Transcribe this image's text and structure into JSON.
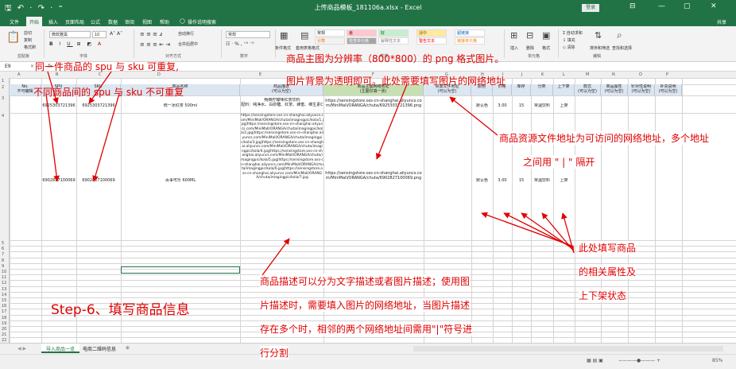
{
  "window": {
    "title": "上传商品模板_181106a.xlsx  -  Excel",
    "quick_access": "🖫 ↶ · ↷ · ⁼",
    "login": "登录",
    "controls": [
      "⊟",
      "—",
      "▢",
      "✕"
    ]
  },
  "menu": {
    "tabs": [
      "文件",
      "开始",
      "插入",
      "页面布局",
      "公式",
      "数据",
      "审阅",
      "视图",
      "帮助"
    ],
    "search": "操作说明搜索",
    "share": "共享"
  },
  "ribbon": {
    "clipboard": {
      "cut": "剪切",
      "copy": "复制",
      "format_painter": "格式刷",
      "group": "剪贴板"
    },
    "font": {
      "name": "微软雅黑",
      "size": "10",
      "group": "字体"
    },
    "alignment": {
      "wrap": "自动换行",
      "merge": "合并后居中",
      "group": "对齐方式"
    },
    "number": {
      "format": "常规",
      "group": "数字"
    },
    "styles": {
      "conditional": "条件格式",
      "table": "套用表格格式",
      "cells": [
        {
          "label": "常规",
          "bg": "#ffffff",
          "fg": "#222222"
        },
        {
          "label": "差",
          "bg": "#ffc7ce",
          "fg": "#9c0006"
        },
        {
          "label": "好",
          "bg": "#c6efce",
          "fg": "#006100"
        },
        {
          "label": "适中",
          "bg": "#ffeb9c",
          "fg": "#9c5700"
        },
        {
          "label": "超链接",
          "bg": "#ffffff",
          "fg": "#0563c1"
        },
        {
          "label": "计算",
          "bg": "#f2f2f2",
          "fg": "#fa7d00"
        },
        {
          "label": "检查单元格",
          "bg": "#a5a5a5",
          "fg": "#ffffff"
        },
        {
          "label": "解释性文本",
          "bg": "#ffffff",
          "fg": "#7f7f7f"
        },
        {
          "label": "警告文本",
          "bg": "#ffffff",
          "fg": "#ff0000"
        },
        {
          "label": "链接单元格",
          "bg": "#ffffff",
          "fg": "#fa7d00"
        }
      ],
      "group": "样式"
    },
    "cells": {
      "insert": "插入",
      "delete": "删除",
      "format": "格式",
      "group": "单元格"
    },
    "editing": {
      "autosum": "自动求和",
      "fill": "填充",
      "clear": "清除",
      "sort": "排序和筛选",
      "find": "查找和选择",
      "group": "编辑"
    }
  },
  "formula_bar": {
    "name_box": "E9",
    "fx": "fx"
  },
  "columns": [
    "A",
    "B",
    "C",
    "D",
    "E",
    "F",
    "G",
    "H",
    "I",
    "J",
    "K",
    "L",
    "M",
    "N",
    "O",
    "P"
  ],
  "header_row": {
    "a": "No.\n不可编辑",
    "b": "SPU",
    "c": "SKU",
    "d": "商品名称",
    "e": "商品描述\n(可以为空)",
    "f": "商品主图网络地址\n(主图仅填一张)",
    "g": "资源文件地址\n(可以为空)",
    "h": "颜色",
    "i": "价格",
    "j": "库存",
    "k": "分类",
    "l": "上下架",
    "m": "款式\n(可以为空)",
    "n": "商品属性\n(可以为空)",
    "o": "针对性说明\n(可以为空)",
    "p": "补充说明\n(可以为空)"
  },
  "rows": [
    {
      "spu": "6925303721396",
      "sku": "6925303721396",
      "name": "统一冰红茶 500ml",
      "desc": "畅爽柠檬味红茶饮料\n配料：纯净水、白砂糖、红茶、蜂蜜、维生素C",
      "image": "https://sensingstore.oss-cn-shanghai.aliyuncs.com/MiniMall/ORANGA/chuta/6925303721396.png",
      "color": "默认色",
      "price": "3.00",
      "stock": "15",
      "category": "常温饮料",
      "shelf": "上架"
    },
    {
      "spu": "6902827100069",
      "sku": "6902827100069",
      "name": "百事可乐 600ML",
      "desc": "https://sensingstore.oss-cn-shanghai.aliyuncs.com/MiniMall/ORANGA/chuta/imagingpic/kola/1.jpg|https://sensingstore.oss-cn-shanghai.aliyuncs.com/MiniMall/ORANGA/chuta/imagingpic/kola/2.jpg|https://sensingstore.oss-cn-shanghai.aliyuncs.com/MiniMall/ORANGA/chuta/imagingpic/kola/3.jpg|https://sensingstore.oss-cn-shanghai.aliyuncs.com/MiniMall/ORANGA/chuta/imagingpic/kola/4.jpg|https://sensingstore.oss-cn-shanghai.aliyuncs.com/MiniMall/ORANGA/chuta/imagingpic/kola/5.jpg|https://sensingstore.oss-cn-shanghai.aliyuncs.com/MiniMall/ORANGA/chuta/imagingpic/kola/6.jpg|https://sensingstore.oss-cn-shanghai.aliyuncs.com/MiniMall/ORANGA/chuta/imagingpic/kola/7.jpg",
      "image": "https://sensingstore.oss-cn-shanghai.aliyuncs.com/MiniMall/ORANGA/chuta/6902827100069.png",
      "color": "默认色",
      "price": "3.00",
      "stock": "15",
      "category": "常温饮料",
      "shelf": "上架"
    }
  ],
  "row_numbers": [
    "1",
    "2",
    "3",
    "4",
    "5",
    "6",
    "7",
    "8",
    "9",
    "10",
    "11",
    "12",
    "13",
    "14",
    "15",
    "16",
    "17",
    "18",
    "19",
    "20",
    "21",
    "22"
  ],
  "sheet_tabs": [
    "导入商品一览",
    "电商二维码信息"
  ],
  "status": {
    "zoom": "85%"
  },
  "annotations": {
    "same_product": "同一件商品的 spu 与 sku 可重复,",
    "diff_product": "不同商品间的 spu 与 sku 不可重复",
    "image_res": "商品主图为分辨率（800*800）的 png 格式图片。",
    "image_bg": "图片背景为透明即可。此处需要填写图片的网络地址",
    "resource_1": "商品资源文件地址为可访问的网络地址，多个地址",
    "resource_2": "之间用 \" | \" 隔开",
    "attr_1": "此处填写商品",
    "attr_2": "的相关属性及",
    "attr_3": "上下架状态",
    "desc_1": "商品描述可以分为文字描述或者图片描述；使用图",
    "desc_2": "片描述时，需要填入图片的网络地址，当图片描述",
    "desc_3": "存在多个时，相邻的两个网络地址间需用\"|\"符号进",
    "desc_4": "行分割",
    "step": "Step-6、填写商品信息"
  }
}
